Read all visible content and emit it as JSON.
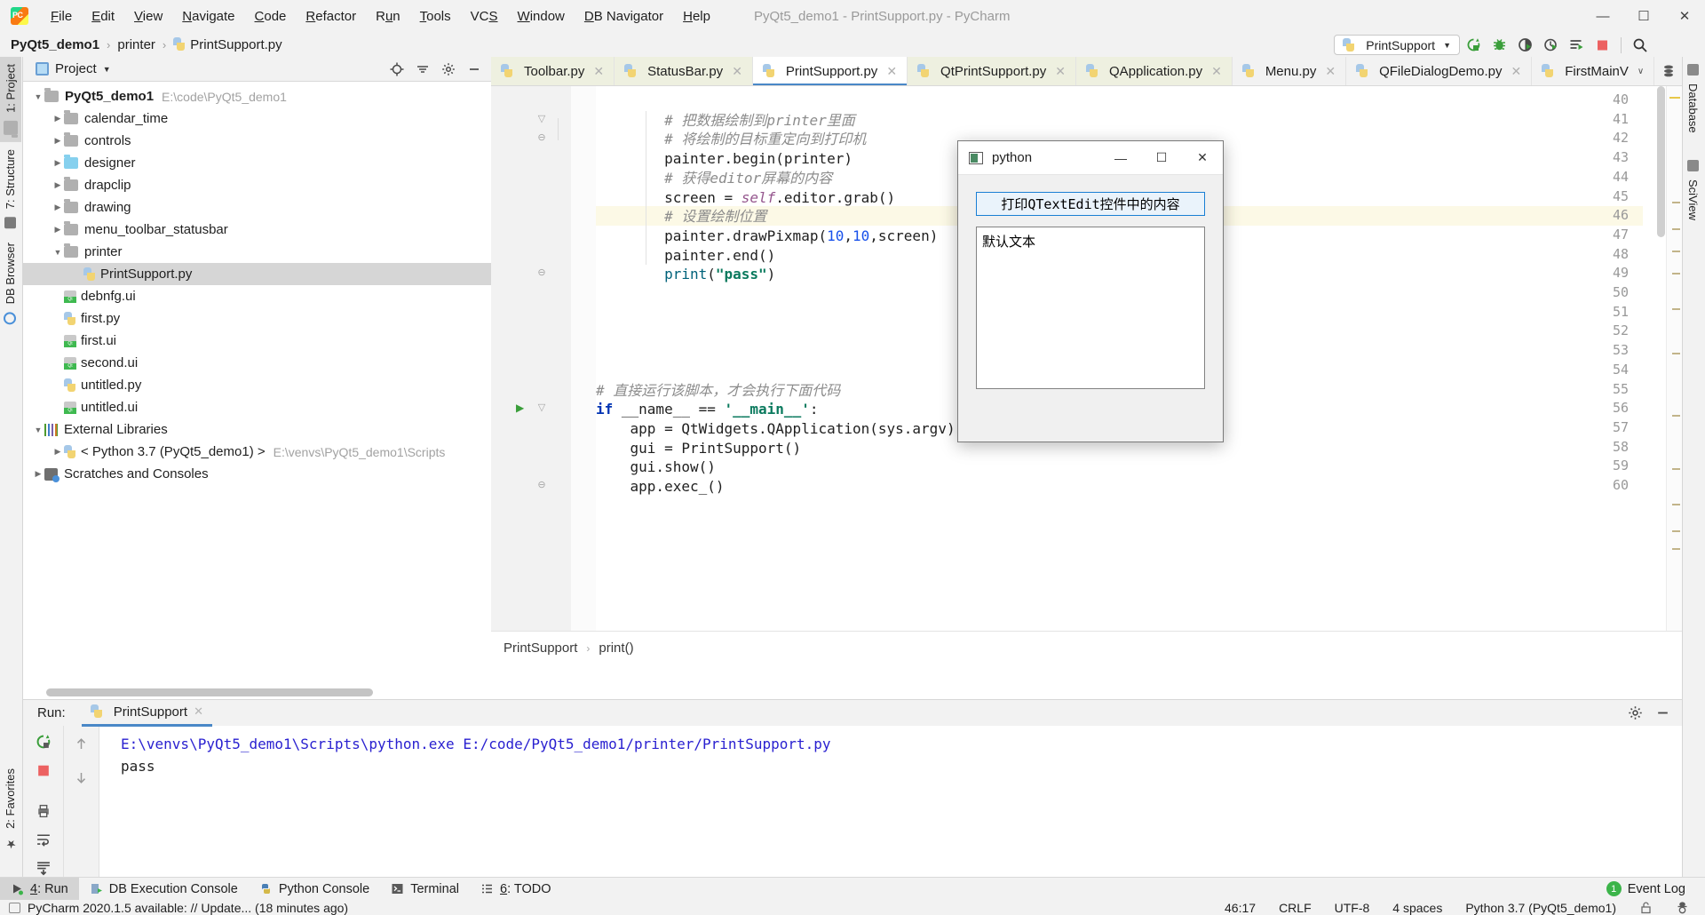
{
  "window": {
    "title": "PyQt5_demo1 - PrintSupport.py - PyCharm",
    "minimize": "—",
    "maximize": "☐",
    "close": "✕"
  },
  "menubar": {
    "items": [
      "File",
      "Edit",
      "View",
      "Navigate",
      "Code",
      "Refactor",
      "Run",
      "Tools",
      "VCS",
      "Window",
      "DB Navigator",
      "Help"
    ]
  },
  "breadcrumb": {
    "project": "PyQt5_demo1",
    "folder": "printer",
    "file": "PrintSupport.py",
    "separator": "›"
  },
  "toolbar": {
    "run_config": "PrintSupport",
    "caret": "▼",
    "icons": [
      "rerun-icon",
      "debug-icon",
      "coverage-icon",
      "profile-icon",
      "run-with-console-icon",
      "stop-icon",
      "search-everywhere-icon"
    ]
  },
  "left_tool_strip": {
    "tabs": [
      "1: Project",
      "7: Structure",
      "DB Browser"
    ],
    "bottom_tabs": [
      "2: Favorites"
    ]
  },
  "right_tool_strip": {
    "tabs": [
      "Database",
      "SciView"
    ]
  },
  "project_panel": {
    "header": "Project",
    "header_caret": "▼",
    "tools": [
      "locate-icon",
      "collapse-all-icon",
      "settings-icon",
      "hide-icon"
    ],
    "tree": [
      {
        "label": "PyQt5_demo1",
        "path": "E:\\code\\PyQt5_demo1",
        "type": "root",
        "indent": 0,
        "arrow": "▼",
        "bold": true,
        "selected": false
      },
      {
        "label": "calendar_time",
        "path": "",
        "type": "folder",
        "indent": 1,
        "arrow": "▶",
        "bold": false,
        "selected": false
      },
      {
        "label": "controls",
        "path": "",
        "type": "folder",
        "indent": 1,
        "arrow": "▶",
        "bold": false,
        "selected": false
      },
      {
        "label": "designer",
        "path": "",
        "type": "folder-blue",
        "indent": 1,
        "arrow": "▶",
        "bold": false,
        "selected": false
      },
      {
        "label": "drapclip",
        "path": "",
        "type": "folder",
        "indent": 1,
        "arrow": "▶",
        "bold": false,
        "selected": false
      },
      {
        "label": "drawing",
        "path": "",
        "type": "folder",
        "indent": 1,
        "arrow": "▶",
        "bold": false,
        "selected": false
      },
      {
        "label": "menu_toolbar_statusbar",
        "path": "",
        "type": "folder",
        "indent": 1,
        "arrow": "▶",
        "bold": false,
        "selected": false
      },
      {
        "label": "printer",
        "path": "",
        "type": "folder",
        "indent": 1,
        "arrow": "▼",
        "bold": false,
        "selected": false
      },
      {
        "label": "PrintSupport.py",
        "path": "",
        "type": "python",
        "indent": 2,
        "arrow": "",
        "bold": false,
        "selected": true
      },
      {
        "label": "debnfg.ui",
        "path": "",
        "type": "qt",
        "indent": 1,
        "arrow": "",
        "bold": false,
        "selected": false
      },
      {
        "label": "first.py",
        "path": "",
        "type": "python",
        "indent": 1,
        "arrow": "",
        "bold": false,
        "selected": false
      },
      {
        "label": "first.ui",
        "path": "",
        "type": "qt",
        "indent": 1,
        "arrow": "",
        "bold": false,
        "selected": false
      },
      {
        "label": "second.ui",
        "path": "",
        "type": "qt",
        "indent": 1,
        "arrow": "",
        "bold": false,
        "selected": false
      },
      {
        "label": "untitled.py",
        "path": "",
        "type": "python",
        "indent": 1,
        "arrow": "",
        "bold": false,
        "selected": false
      },
      {
        "label": "untitled.ui",
        "path": "",
        "type": "qt",
        "indent": 1,
        "arrow": "",
        "bold": false,
        "selected": false
      },
      {
        "label": "External Libraries",
        "path": "",
        "type": "library",
        "indent": 0,
        "arrow": "▼",
        "bold": false,
        "selected": false
      },
      {
        "label": "< Python 3.7 (PyQt5_demo1) >",
        "path": "E:\\venvs\\PyQt5_demo1\\Scripts",
        "type": "python-interp",
        "indent": 1,
        "arrow": "▶",
        "bold": false,
        "selected": false
      },
      {
        "label": "Scratches and Consoles",
        "path": "",
        "type": "scratches",
        "indent": 0,
        "arrow": "▶",
        "bold": false,
        "selected": false
      }
    ]
  },
  "editor": {
    "tabs": [
      {
        "label": "Toolbar.py",
        "active": false,
        "modified": true,
        "close": "✕"
      },
      {
        "label": "StatusBar.py",
        "active": false,
        "modified": true,
        "close": "✕"
      },
      {
        "label": "PrintSupport.py",
        "active": true,
        "modified": false,
        "close": "✕"
      },
      {
        "label": "QtPrintSupport.py",
        "active": false,
        "modified": true,
        "close": "✕"
      },
      {
        "label": "QApplication.py",
        "active": false,
        "modified": true,
        "close": "✕"
      },
      {
        "label": "Menu.py",
        "active": false,
        "modified": false,
        "close": "✕"
      },
      {
        "label": "QFileDialogDemo.py",
        "active": false,
        "modified": false,
        "close": "✕"
      },
      {
        "label": "FirstMainV",
        "active": false,
        "modified": false,
        "close": "∨"
      }
    ],
    "first_line_number": 40,
    "highlighted_line": 46,
    "lines": [
      {
        "n": 40,
        "fold": "",
        "run": false,
        "tokens": []
      },
      {
        "n": 41,
        "fold": "▽",
        "run": false,
        "tokens": [
          {
            "t": "        # 把数据绘制到printer里面",
            "c": "cm"
          }
        ]
      },
      {
        "n": 42,
        "fold": "⊖",
        "run": false,
        "tokens": [
          {
            "t": "        # 将绘制的目标重定向到打印机",
            "c": "cm"
          }
        ]
      },
      {
        "n": 43,
        "fold": "",
        "run": false,
        "tokens": [
          {
            "t": "        painter.begin(printer)",
            "c": "pl"
          }
        ]
      },
      {
        "n": 44,
        "fold": "",
        "run": false,
        "tokens": [
          {
            "t": "        # 获得editor屏幕的内容",
            "c": "cm"
          }
        ]
      },
      {
        "n": 45,
        "fold": "",
        "run": false,
        "tokens": [
          {
            "t": "        screen = ",
            "c": "pl"
          },
          {
            "t": "self",
            "c": "self"
          },
          {
            "t": ".editor.grab()",
            "c": "pl"
          }
        ]
      },
      {
        "n": 46,
        "fold": "",
        "run": false,
        "tokens": [
          {
            "t": "        # 设置绘制位置",
            "c": "cm"
          }
        ]
      },
      {
        "n": 47,
        "fold": "",
        "run": false,
        "tokens": [
          {
            "t": "        painter.drawPixmap(",
            "c": "pl"
          },
          {
            "t": "10",
            "c": "num"
          },
          {
            "t": ",",
            "c": "pl"
          },
          {
            "t": "10",
            "c": "num"
          },
          {
            "t": ",screen)",
            "c": "pl"
          }
        ]
      },
      {
        "n": 48,
        "fold": "",
        "run": false,
        "tokens": [
          {
            "t": "        painter.end()",
            "c": "pl"
          }
        ]
      },
      {
        "n": 49,
        "fold": "⊖",
        "run": false,
        "tokens": [
          {
            "t": "        ",
            "c": "pl"
          },
          {
            "t": "print",
            "c": "fn"
          },
          {
            "t": "(",
            "c": "pl"
          },
          {
            "t": "\"pass\"",
            "c": "str"
          },
          {
            "t": ")",
            "c": "pl"
          }
        ]
      },
      {
        "n": 50,
        "fold": "",
        "run": false,
        "tokens": []
      },
      {
        "n": 51,
        "fold": "",
        "run": false,
        "tokens": []
      },
      {
        "n": 52,
        "fold": "",
        "run": false,
        "tokens": []
      },
      {
        "n": 53,
        "fold": "",
        "run": false,
        "tokens": []
      },
      {
        "n": 54,
        "fold": "",
        "run": false,
        "tokens": []
      },
      {
        "n": 55,
        "fold": "",
        "run": false,
        "tokens": [
          {
            "t": "# 直接运行该脚本，才会执行下面代码",
            "c": "cm"
          }
        ]
      },
      {
        "n": 56,
        "fold": "▽",
        "run": true,
        "tokens": [
          {
            "t": "if",
            "c": "kw"
          },
          {
            "t": " __name__ == ",
            "c": "pl"
          },
          {
            "t": "'__main__'",
            "c": "str"
          },
          {
            "t": ":",
            "c": "pl"
          }
        ]
      },
      {
        "n": 57,
        "fold": "",
        "run": false,
        "tokens": [
          {
            "t": "    app = QtWidgets.QApplication(sys.argv)",
            "c": "pl"
          }
        ]
      },
      {
        "n": 58,
        "fold": "",
        "run": false,
        "tokens": [
          {
            "t": "    gui = PrintSupport()",
            "c": "pl"
          }
        ]
      },
      {
        "n": 59,
        "fold": "",
        "run": false,
        "tokens": [
          {
            "t": "    gui.show()",
            "c": "pl"
          }
        ]
      },
      {
        "n": 60,
        "fold": "⊖",
        "run": false,
        "tokens": [
          {
            "t": "    app.exec_()",
            "c": "pl"
          }
        ]
      }
    ],
    "breadcrumb": {
      "class": "PrintSupport",
      "method": "print()",
      "separator": "›"
    }
  },
  "python_dialog": {
    "title": "python",
    "minimize": "—",
    "maximize": "☐",
    "close": "✕",
    "button_label": "打印QTextEdit控件中的内容",
    "textedit_value": "默认文本"
  },
  "run_panel": {
    "label": "Run:",
    "tab": "PrintSupport",
    "tab_close": "✕",
    "console_command": "E:\\venvs\\PyQt5_demo1\\Scripts\\python.exe E:/code/PyQt5_demo1/printer/PrintSupport.py",
    "console_output": "pass",
    "tools": [
      "settings-icon",
      "hide-icon"
    ],
    "left_tools": [
      "rerun-icon",
      "stop-icon",
      "print-icon",
      "soft-wrap-icon",
      "scroll-to-end-icon"
    ],
    "nav_tools": [
      "up-arrow-icon",
      "down-arrow-icon"
    ]
  },
  "bottom_bar": {
    "tabs": [
      {
        "label": "4: Run",
        "active": true,
        "icon": "run-icon"
      },
      {
        "label": "DB Execution Console",
        "active": false,
        "icon": "db-console-icon"
      },
      {
        "label": "Python Console",
        "active": false,
        "icon": "python-console-icon"
      },
      {
        "label": "Terminal",
        "active": false,
        "icon": "terminal-icon"
      },
      {
        "label": "6: TODO",
        "active": false,
        "icon": "todo-icon"
      }
    ],
    "event_log": "Event Log",
    "event_count": "1"
  },
  "status_bar": {
    "message": "PyCharm 2020.1.5 available: // Update... (18 minutes ago)",
    "caret_position": "46:17",
    "line_separator": "CRLF",
    "encoding": "UTF-8",
    "indent": "4 spaces",
    "interpreter": "Python 3.7 (PyQt5_demo1)"
  }
}
